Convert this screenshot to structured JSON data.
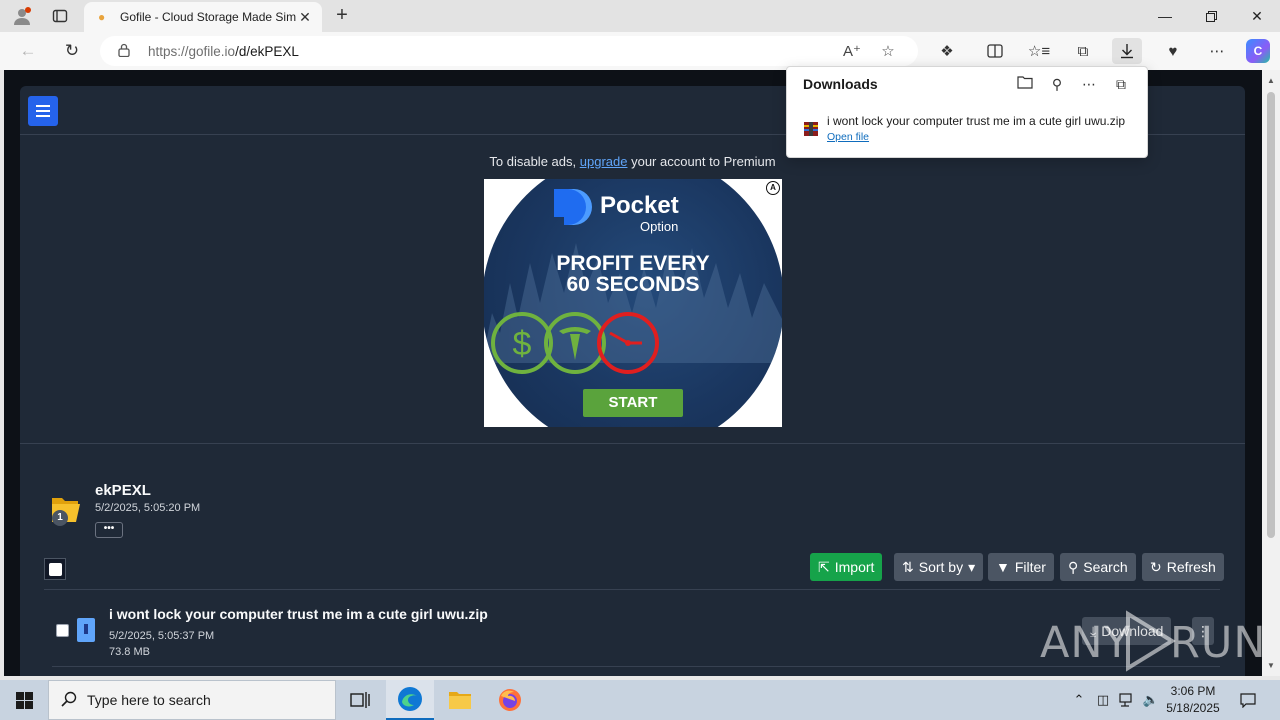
{
  "browser": {
    "tab_title": "Gofile - Cloud Storage Made Simple",
    "url_host": "https://gofile.io",
    "url_path": "/d/ekPEXL",
    "icons": {
      "profile": "profile-icon",
      "tab_actions": "tab-actions-icon",
      "tab_favicon": "gofile-favicon",
      "close_tab": "close-icon",
      "new_tab": "plus-icon",
      "minimize": "minimize-icon",
      "restore": "restore-icon",
      "close_window": "close-icon",
      "back": "back-arrow-icon",
      "refresh": "refresh-icon",
      "lock": "lock-icon",
      "read_aloud": "read-aloud-icon",
      "favorite": "star-icon",
      "extensions": "puzzle-icon",
      "split_screen": "split-screen-icon",
      "favorites": "favorites-icon",
      "collections": "collections-icon",
      "downloads": "download-icon",
      "browser_essentials": "heart-pulse-icon",
      "settings": "more-icon",
      "copilot": "copilot-icon"
    }
  },
  "downloads_flyout": {
    "title": "Downloads",
    "icons": [
      "folder-icon",
      "search-icon",
      "more-icon",
      "pin-icon"
    ],
    "item_name": "i wont lock your computer trust me im a cute girl uwu.zip",
    "item_action": "Open file"
  },
  "page": {
    "ad_notice_prefix": "To disable ads,",
    "ad_notice_link": "upgrade",
    "ad_notice_suffix": "your account to Premium",
    "ad": {
      "brand": "Pocket",
      "brand_sub": "Option",
      "headline_1": "PROFIT EVERY",
      "headline_2": "60 SECONDS",
      "cta": "START",
      "colors": {
        "circle": "#1a365f",
        "cta": "#5aa33c",
        "coin": "#6fb23f",
        "clock": "#e01f1f"
      }
    },
    "folder": {
      "name": "ekPEXL",
      "date": "5/2/2025, 5:05:20 PM",
      "badge": "1",
      "more_label": "•••"
    },
    "toolbar": {
      "import": "Import",
      "sort": "Sort by",
      "filter": "Filter",
      "search": "Search",
      "refresh": "Refresh"
    },
    "file": {
      "name": "i wont lock your computer trust me im a cute girl uwu.zip",
      "date": "5/2/2025, 5:05:37 PM",
      "size": "73.8 MB",
      "download": "Download"
    },
    "watermark": {
      "left": "ANY",
      "right": "RUN"
    },
    "colors": {
      "panel": "#1f2937",
      "accent": "#2563eb",
      "import": "#16a34a",
      "button": "#4b5563"
    }
  },
  "taskbar": {
    "search_placeholder": "Type here to search",
    "time": "3:06 PM",
    "date": "5/18/2025",
    "apps": [
      "task-view-icon",
      "edge-icon",
      "file-explorer-icon",
      "firefox-icon"
    ],
    "tray_icons": [
      "chevron-up-icon",
      "device-icon",
      "network-icon",
      "volume-icon",
      "notification-icon"
    ]
  }
}
